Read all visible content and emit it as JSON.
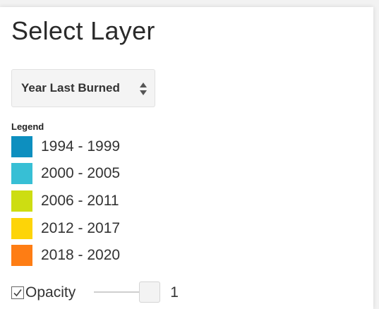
{
  "header": {
    "title": "Select Layer"
  },
  "layer_select": {
    "selected": "Year Last Burned"
  },
  "legend": {
    "title": "Legend",
    "items": [
      {
        "label": "1994 - 1999",
        "color": "#0d8fbf"
      },
      {
        "label": "2000 - 2005",
        "color": "#37bfd5"
      },
      {
        "label": "2006 - 2011",
        "color": "#cddd12"
      },
      {
        "label": "2012 - 2017",
        "color": "#fdd408"
      },
      {
        "label": "2018 - 2020",
        "color": "#fe7d14"
      }
    ]
  },
  "opacity": {
    "label": "Opacity",
    "checked": true,
    "value": "1",
    "level": 1
  }
}
